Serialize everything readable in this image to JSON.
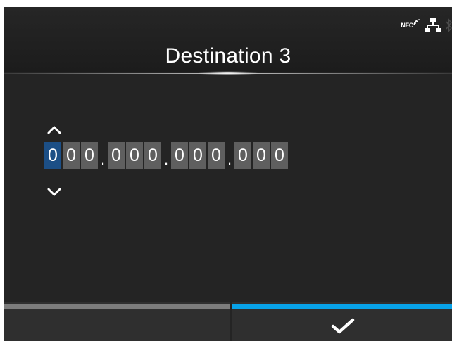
{
  "header": {
    "title": "Destination 3",
    "status": {
      "nfc_label": "NFC",
      "icons": [
        "nfc-icon",
        "network-icon",
        "bluetooth-icon"
      ]
    }
  },
  "ip_editor": {
    "octets": [
      [
        "0",
        "0",
        "0"
      ],
      [
        "0",
        "0",
        "0"
      ],
      [
        "0",
        "0",
        "0"
      ],
      [
        "0",
        "0",
        "0"
      ]
    ],
    "separator": ".",
    "selected_digit": 0,
    "up_icon": "chevron-up-icon",
    "down_icon": "chevron-down-icon"
  },
  "footer": {
    "left_button_icon": "none",
    "right_button_icon": "check-icon"
  },
  "colors": {
    "background": "#242424",
    "digit_box": "#5f5f5f",
    "selected_digit_box": "#1c4f86",
    "left_bar": "#7c7c7c",
    "right_bar": "#08a2e8"
  }
}
